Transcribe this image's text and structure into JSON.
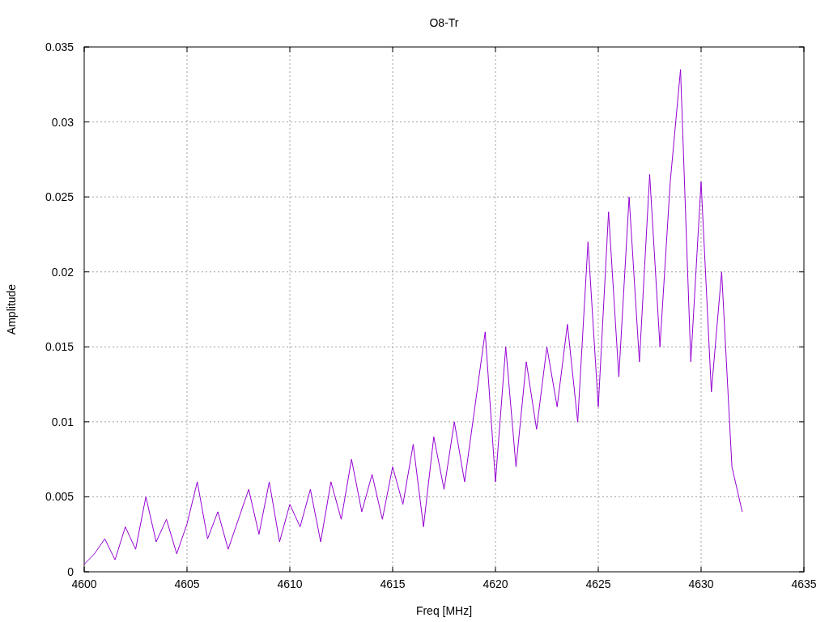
{
  "chart": {
    "chart_data": {
      "type": "line",
      "title": "O8-Tr",
      "xlabel": "Freq [MHz]",
      "ylabel": "Amplitude",
      "grid": true,
      "xlim": [
        4600,
        4635
      ],
      "ylim": [
        0,
        0.035
      ],
      "xticks": [
        4600,
        4605,
        4610,
        4615,
        4620,
        4625,
        4630,
        4635
      ],
      "yticks": [
        {
          "value": 0,
          "label": "0"
        },
        {
          "value": 0.005,
          "label": "0.005"
        },
        {
          "value": 0.01,
          "label": "0.01"
        },
        {
          "value": 0.015,
          "label": "0.015"
        },
        {
          "value": 0.02,
          "label": "0.02"
        },
        {
          "value": 0.025,
          "label": "0.025"
        },
        {
          "value": 0.03,
          "label": "0.03"
        },
        {
          "value": 0.035,
          "label": "0.035"
        }
      ],
      "x": [
        4600,
        4600.5,
        4601,
        4601.5,
        4602,
        4602.5,
        4603,
        4603.5,
        4604,
        4604.5,
        4605,
        4605.5,
        4606,
        4606.5,
        4607,
        4607.5,
        4608,
        4608.5,
        4609,
        4609.5,
        4610,
        4610.5,
        4611,
        4611.5,
        4612,
        4612.5,
        4613,
        4613.5,
        4614,
        4614.5,
        4615,
        4615.5,
        4616,
        4616.5,
        4617,
        4617.5,
        4618,
        4618.5,
        4619,
        4619.5,
        4620,
        4620.5,
        4621,
        4621.5,
        4622,
        4622.5,
        4623,
        4623.5,
        4624,
        4624.5,
        4625,
        4625.5,
        4626,
        4626.5,
        4627,
        4627.5,
        4628,
        4628.5,
        4629,
        4629.5,
        4630,
        4630.5,
        4631,
        4631.5,
        4632
      ],
      "series": [
        {
          "color": "#9400d3",
          "values": [
            0.0005,
            0.0012,
            0.0022,
            0.0008,
            0.003,
            0.0015,
            0.005,
            0.002,
            0.0035,
            0.0012,
            0.0032,
            0.006,
            0.0022,
            0.004,
            0.0015,
            0.0035,
            0.0055,
            0.0025,
            0.006,
            0.002,
            0.0045,
            0.003,
            0.0055,
            0.002,
            0.006,
            0.0035,
            0.0075,
            0.004,
            0.0065,
            0.0035,
            0.007,
            0.0045,
            0.0085,
            0.003,
            0.009,
            0.0055,
            0.01,
            0.006,
            0.011,
            0.016,
            0.006,
            0.015,
            0.007,
            0.014,
            0.0095,
            0.015,
            0.011,
            0.0165,
            0.01,
            0.022,
            0.011,
            0.024,
            0.013,
            0.025,
            0.014,
            0.0265,
            0.015,
            0.026,
            0.0335,
            0.014,
            0.026,
            0.012,
            0.02,
            0.007,
            0.004
          ]
        }
      ]
    }
  }
}
